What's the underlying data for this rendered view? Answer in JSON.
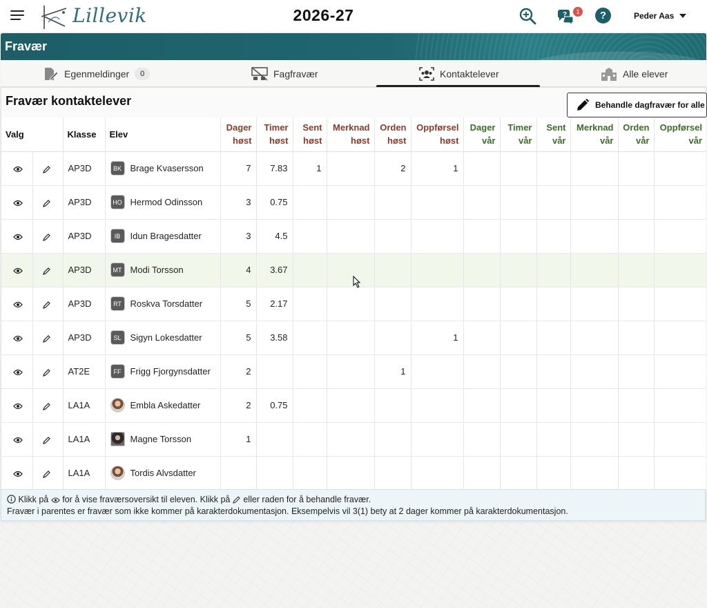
{
  "header": {
    "logo_text": "Lillevik",
    "year": "2026-27",
    "notification_count": "1",
    "user_name": "Peder Aas"
  },
  "banner": {
    "title": "Fravær"
  },
  "tabs": [
    {
      "label": "Egenmeldinger",
      "count": "0",
      "icon": "pencil-document-icon"
    },
    {
      "label": "Fagfravær",
      "icon": "empty-classroom-icon"
    },
    {
      "label": "Kontaktelever",
      "icon": "contact-students-icon",
      "active": true
    },
    {
      "label": "Alle elever",
      "icon": "school-building-icon"
    }
  ],
  "panel": {
    "title": "Fravær kontaktelever",
    "action_label": "Behandle dagfravær for alle"
  },
  "table": {
    "headers": {
      "valg": "Valg",
      "klasse": "Klasse",
      "elev": "Elev",
      "dager_host": [
        "Dager",
        "høst"
      ],
      "timer_host": [
        "Timer",
        "høst"
      ],
      "sent_host": [
        "Sent",
        "høst"
      ],
      "merknad_host": [
        "Merknad",
        "høst"
      ],
      "orden_host": [
        "Orden",
        "høst"
      ],
      "oppforsel_host": [
        "Oppførsel",
        "høst"
      ],
      "dager_var": [
        "Dager",
        "vår"
      ],
      "timer_var": [
        "Timer",
        "vår"
      ],
      "sent_var": [
        "Sent",
        "vår"
      ],
      "merknad_var": [
        "Merknad",
        "vår"
      ],
      "orden_var": [
        "Orden",
        "vår"
      ],
      "oppforsel_var": [
        "Oppførsel",
        "vår"
      ]
    },
    "rows": [
      {
        "klasse": "AP3D",
        "initials": "BK",
        "name": "Brage Kvasersson",
        "dager_host": "7",
        "timer_host": "7.83",
        "sent_host": "1",
        "merknad_host": "",
        "orden_host": "2",
        "oppforsel_host": "1"
      },
      {
        "klasse": "AP3D",
        "initials": "HO",
        "name": "Hermod Odinsson",
        "dager_host": "3",
        "timer_host": "0.75",
        "sent_host": "",
        "merknad_host": "",
        "orden_host": "",
        "oppforsel_host": ""
      },
      {
        "klasse": "AP3D",
        "initials": "IB",
        "name": "Idun Bragesdatter",
        "dager_host": "3",
        "timer_host": "4.5",
        "sent_host": "",
        "merknad_host": "",
        "orden_host": "",
        "oppforsel_host": ""
      },
      {
        "klasse": "AP3D",
        "initials": "MT",
        "name": "Modi Torsson",
        "dager_host": "4",
        "timer_host": "3.67",
        "sent_host": "",
        "merknad_host": "",
        "orden_host": "",
        "oppforsel_host": "",
        "highlighted": true
      },
      {
        "klasse": "AP3D",
        "initials": "RT",
        "name": "Roskva Torsdatter",
        "dager_host": "5",
        "timer_host": "2.17",
        "sent_host": "",
        "merknad_host": "",
        "orden_host": "",
        "oppforsel_host": ""
      },
      {
        "klasse": "AP3D",
        "initials": "SL",
        "name": "Sigyn Lokesdatter",
        "dager_host": "5",
        "timer_host": "3.58",
        "sent_host": "",
        "merknad_host": "",
        "orden_host": "",
        "oppforsel_host": "1"
      },
      {
        "klasse": "AT2E",
        "initials": "FF",
        "name": "Frigg Fjorgynsdatter",
        "dager_host": "2",
        "timer_host": "",
        "sent_host": "",
        "merknad_host": "",
        "orden_host": "1",
        "oppforsel_host": ""
      },
      {
        "klasse": "LA1A",
        "initials": "",
        "photo": "photo",
        "name": "Embla Askedatter",
        "dager_host": "2",
        "timer_host": "0.75",
        "sent_host": "",
        "merknad_host": "",
        "orden_host": "",
        "oppforsel_host": ""
      },
      {
        "klasse": "LA1A",
        "initials": "",
        "photo": "photo2",
        "name": "Magne Torsson",
        "dager_host": "1",
        "timer_host": "",
        "sent_host": "",
        "merknad_host": "",
        "orden_host": "",
        "oppforsel_host": ""
      },
      {
        "klasse": "LA1A",
        "initials": "",
        "photo": "photo",
        "name": "Tordis Alvsdatter",
        "dager_host": "",
        "timer_host": "",
        "sent_host": "",
        "merknad_host": "",
        "orden_host": "",
        "oppforsel_host": ""
      }
    ]
  },
  "info": {
    "line1_a": "Klikk på",
    "line1_b": "for å vise fraværsoversikt til eleven. Klikk på",
    "line1_c": "eller raden for å behandle fravær.",
    "line2": "Fravær i parentes er fravær som ikke kommer på karakterdokumentasjon. Eksempelvis vil 3(1) bety at 2 dager kommer på karakterdokumentasjon."
  },
  "colors": {
    "banner": "#1f6670",
    "host_header": "#8a3a2a",
    "var_header": "#3d6b29",
    "highlight_row": "#f1f8eb"
  }
}
